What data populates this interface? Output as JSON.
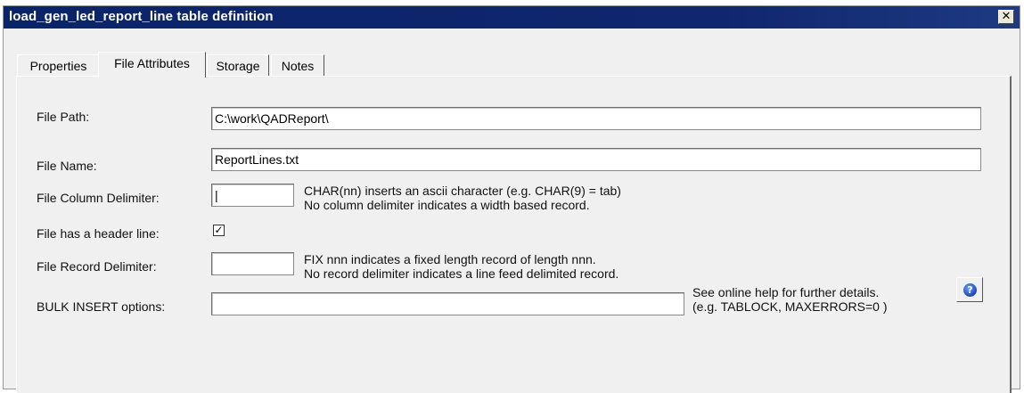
{
  "window": {
    "title": "load_gen_led_report_line table definition",
    "close_symbol": "✕"
  },
  "tabs": [
    {
      "label": "Properties"
    },
    {
      "label": "File Attributes"
    },
    {
      "label": "Storage"
    },
    {
      "label": "Notes"
    }
  ],
  "form": {
    "file_path": {
      "label": "File Path:",
      "value": "C:\\work\\QADReport\\"
    },
    "file_name": {
      "label": "File Name:",
      "value": "ReportLines.txt"
    },
    "column_delimiter": {
      "label": "File Column Delimiter:",
      "value": "|",
      "hint_line1": "CHAR(nn) inserts an ascii character (e.g. CHAR(9) = tab)",
      "hint_line2": "No column delimiter indicates a width based record."
    },
    "header_line": {
      "label": "File has a header line:",
      "checked": true,
      "check_glyph": "✓"
    },
    "record_delimiter": {
      "label": "File Record Delimiter:",
      "value": "",
      "hint_line1": "FIX nnn indicates a fixed length record of length nnn.",
      "hint_line2": "No record delimiter indicates a line feed delimited record."
    },
    "bulk_insert": {
      "label": "BULK INSERT options:",
      "value": "",
      "hint_line1": "See online help for further details.",
      "hint_line2": "(e.g. TABLOCK, MAXERRORS=0 )"
    },
    "help_button": {
      "icon": "help-icon",
      "glyph": "?"
    }
  }
}
